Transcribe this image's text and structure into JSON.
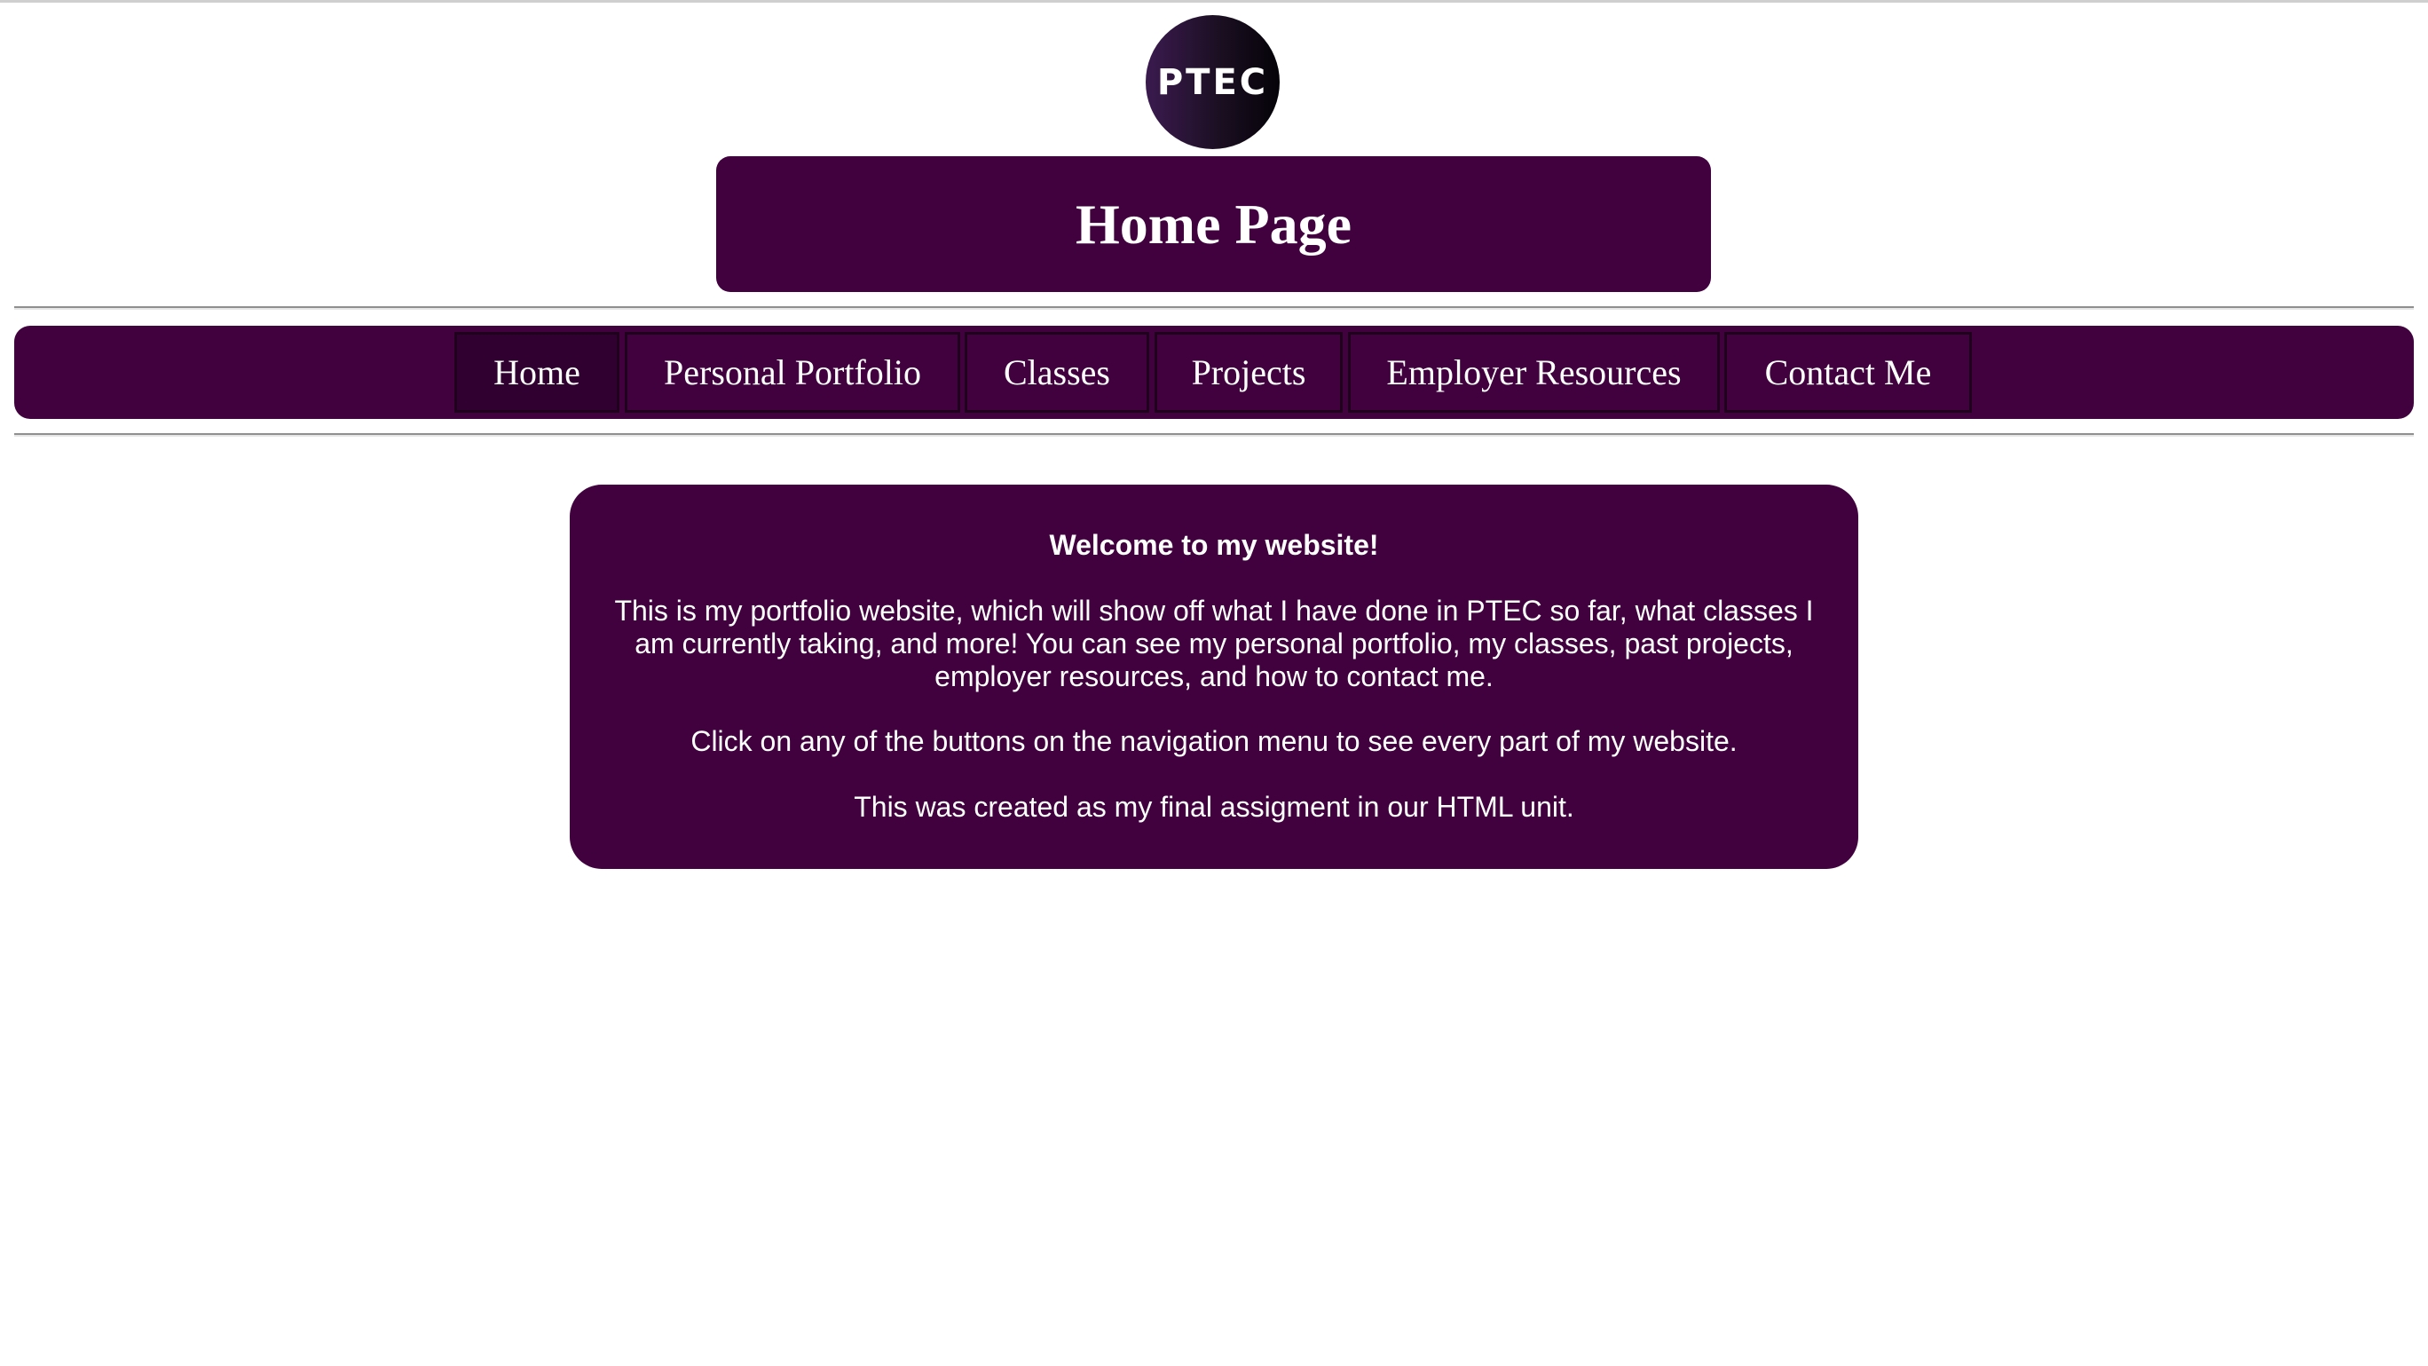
{
  "logo": {
    "text": "PTEC"
  },
  "header": {
    "title": "Home Page"
  },
  "nav": {
    "items": [
      {
        "label": "Home",
        "active": true
      },
      {
        "label": "Personal Portfolio",
        "active": false
      },
      {
        "label": "Classes",
        "active": false
      },
      {
        "label": "Projects",
        "active": false
      },
      {
        "label": "Employer Resources",
        "active": false
      },
      {
        "label": "Contact Me",
        "active": false
      }
    ]
  },
  "content": {
    "welcome": "Welcome to my website!",
    "paragraph1": "This is my portfolio website, which will show off what I have done in PTEC so far, what classes I am currently taking, and more! You can see my personal portfolio, my classes, past projects, employer resources, and how to contact me.",
    "paragraph2": "Click on any of the buttons on the navigation menu to see every part of my website.",
    "paragraph3": "This was created as my final assigment in our HTML unit."
  },
  "colors": {
    "primary": "#41003e",
    "active_nav": "#300030",
    "text": "#ffffff"
  }
}
